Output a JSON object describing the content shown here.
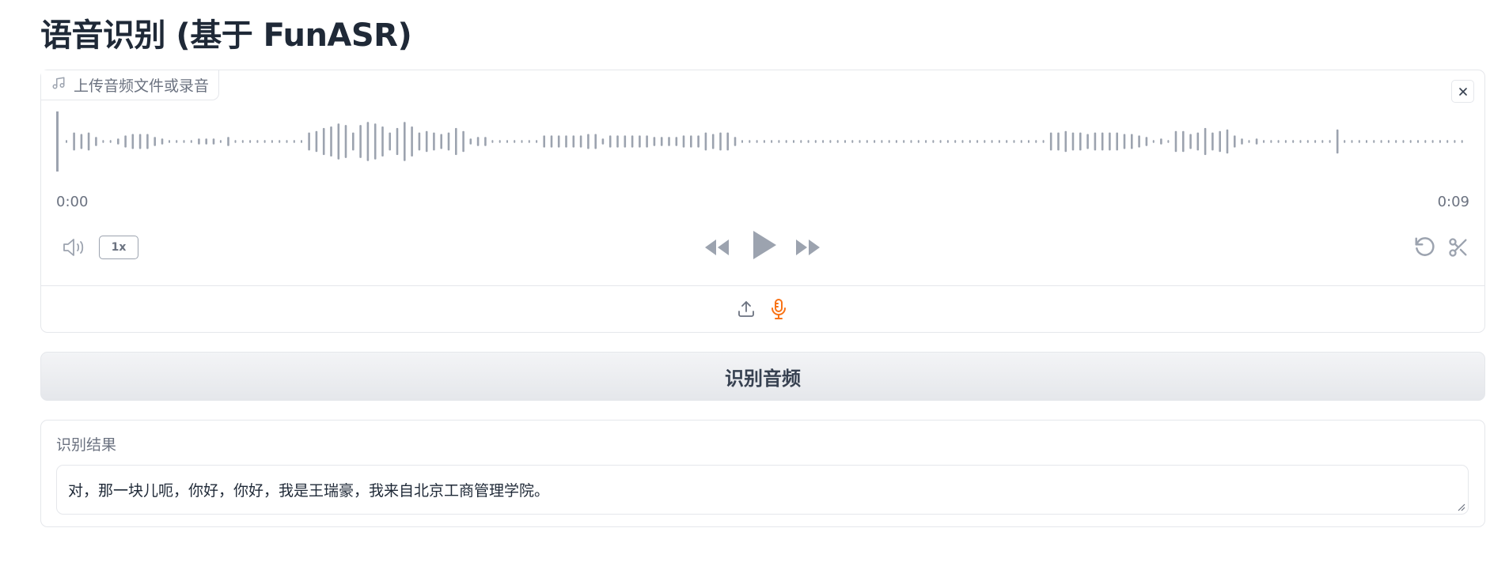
{
  "header": {
    "title": "语音识别 (基于 FunASR)"
  },
  "audio_input": {
    "label": "上传音频文件或录音",
    "label_icon": "music-note-icon",
    "time_start": "0:00",
    "time_end": "0:09",
    "playback_rate": "1x",
    "controls": [
      "volume-icon",
      "rewind-icon",
      "play-icon",
      "fast-forward-icon",
      "undo-icon",
      "scissors-icon",
      "close-icon"
    ],
    "sources": [
      "upload-icon",
      "microphone-icon"
    ],
    "waveform_amplitudes": [
      0.05,
      0.3,
      0.25,
      0.3,
      0.15,
      0.05,
      0.05,
      0.1,
      0.2,
      0.25,
      0.25,
      0.25,
      0.15,
      0.1,
      0.05,
      0.05,
      0.05,
      0.05,
      0.1,
      0.1,
      0.1,
      0.05,
      0.15,
      0.05,
      0.05,
      0.05,
      0.05,
      0.05,
      0.05,
      0.05,
      0.05,
      0.05,
      0.05,
      0.3,
      0.35,
      0.45,
      0.5,
      0.6,
      0.55,
      0.3,
      0.55,
      0.65,
      0.6,
      0.5,
      0.3,
      0.45,
      0.65,
      0.5,
      0.3,
      0.35,
      0.3,
      0.25,
      0.3,
      0.45,
      0.35,
      0.1,
      0.15,
      0.15,
      0.05,
      0.05,
      0.05,
      0.05,
      0.05,
      0.05,
      0.05,
      0.2,
      0.2,
      0.2,
      0.2,
      0.2,
      0.2,
      0.25,
      0.25,
      0.1,
      0.2,
      0.2,
      0.2,
      0.2,
      0.2,
      0.2,
      0.15,
      0.15,
      0.15,
      0.15,
      0.2,
      0.2,
      0.2,
      0.3,
      0.25,
      0.3,
      0.3,
      0.15,
      0.05,
      0.05,
      0.05,
      0.05,
      0.05,
      0.05,
      0.05,
      0.05,
      0.05,
      0.05,
      0.05,
      0.05,
      0.05,
      0.05,
      0.05,
      0.05,
      0.05,
      0.05,
      0.05,
      0.05,
      0.05,
      0.05,
      0.05,
      0.05,
      0.05,
      0.05,
      0.05,
      0.05,
      0.05,
      0.05,
      0.05,
      0.05,
      0.05,
      0.05,
      0.05,
      0.05,
      0.05,
      0.05,
      0.05,
      0.05,
      0.05,
      0.05,
      0.3,
      0.3,
      0.35,
      0.3,
      0.3,
      0.25,
      0.3,
      0.3,
      0.3,
      0.3,
      0.25,
      0.25,
      0.2,
      0.15,
      0.05,
      0.1,
      0.05,
      0.35,
      0.35,
      0.25,
      0.3,
      0.45,
      0.3,
      0.35,
      0.4,
      0.2,
      0.1,
      0.05,
      0.1,
      0.05,
      0.05,
      0.05,
      0.05,
      0.05,
      0.05,
      0.05,
      0.05,
      0.05,
      0.05,
      0.4,
      0.05,
      0.05,
      0.05,
      0.05,
      0.05,
      0.05,
      0.05,
      0.05,
      0.05,
      0.05,
      0.05,
      0.05,
      0.05,
      0.05,
      0.05,
      0.05,
      0.05
    ]
  },
  "actions": {
    "recognize_label": "识别音频"
  },
  "result": {
    "label": "识别结果",
    "text": "对，那一块儿呃，你好，你好，我是王瑞豪，我来自北京工商管理学院。"
  },
  "colors": {
    "accent": "#f97316",
    "icon": "#9ca3af",
    "waveform": "#9ca3af",
    "border": "#e5e7eb"
  }
}
